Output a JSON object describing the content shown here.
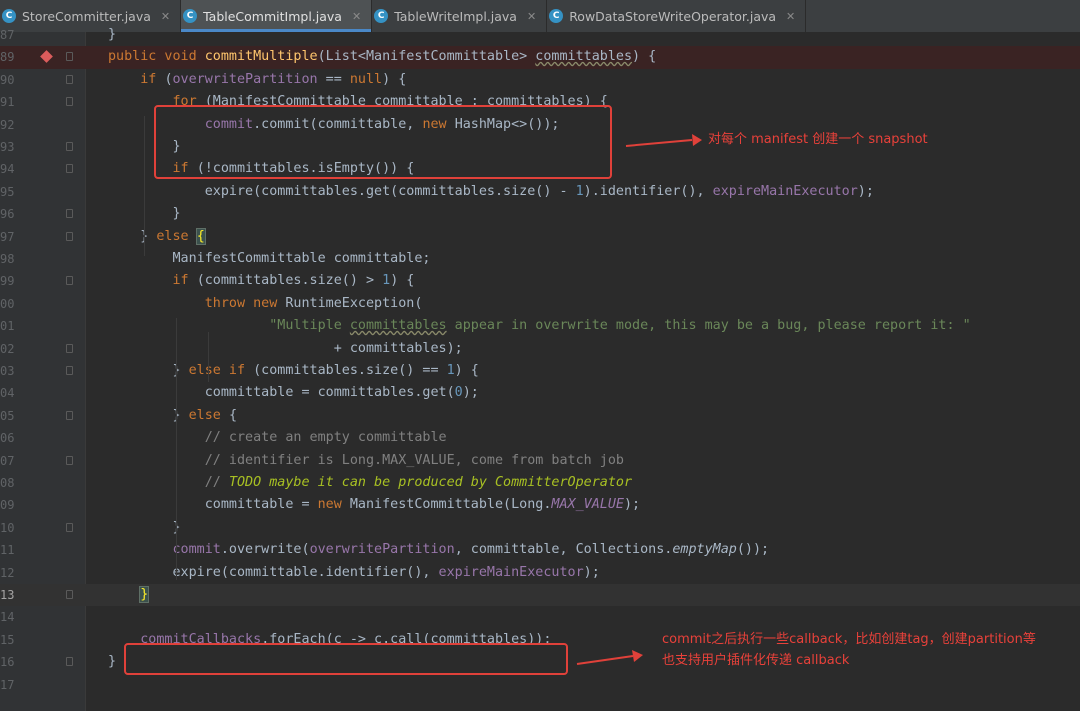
{
  "tabs": [
    {
      "label": "StoreCommitter.java",
      "icon": "class-icon",
      "active": false
    },
    {
      "label": "TableCommitImpl.java",
      "icon": "class-icon",
      "active": true
    },
    {
      "label": "TableWriteImpl.java",
      "icon": "class-icon",
      "active": false
    },
    {
      "label": "RowDataStoreWriteOperator.java",
      "icon": "class-icon",
      "active": false
    }
  ],
  "tab_icon_letter": "C",
  "line_numbers": [
    "87",
    "89",
    "90",
    "91",
    "92",
    "93",
    "94",
    "95",
    "96",
    "97",
    "98",
    "99",
    "00",
    "01",
    "02",
    "03",
    "04",
    "05",
    "06",
    "07",
    "08",
    "09",
    "10",
    "11",
    "12",
    "13",
    "14",
    "15",
    "16",
    "17"
  ],
  "annotations": {
    "note1": "对每个 manifest 创建一个 snapshot",
    "note2_line1": "commit之后执行一些callback，比如创建tag，创建partition等",
    "note2_line2": "也支持用户插件化传递 callback"
  },
  "colors": {
    "background": "#2b2b2b",
    "keyword": "#cc7832",
    "method": "#ffc66d",
    "field": "#9876aa",
    "string": "#6a8759",
    "comment": "#808080",
    "annotation_red": "#e0413a"
  }
}
